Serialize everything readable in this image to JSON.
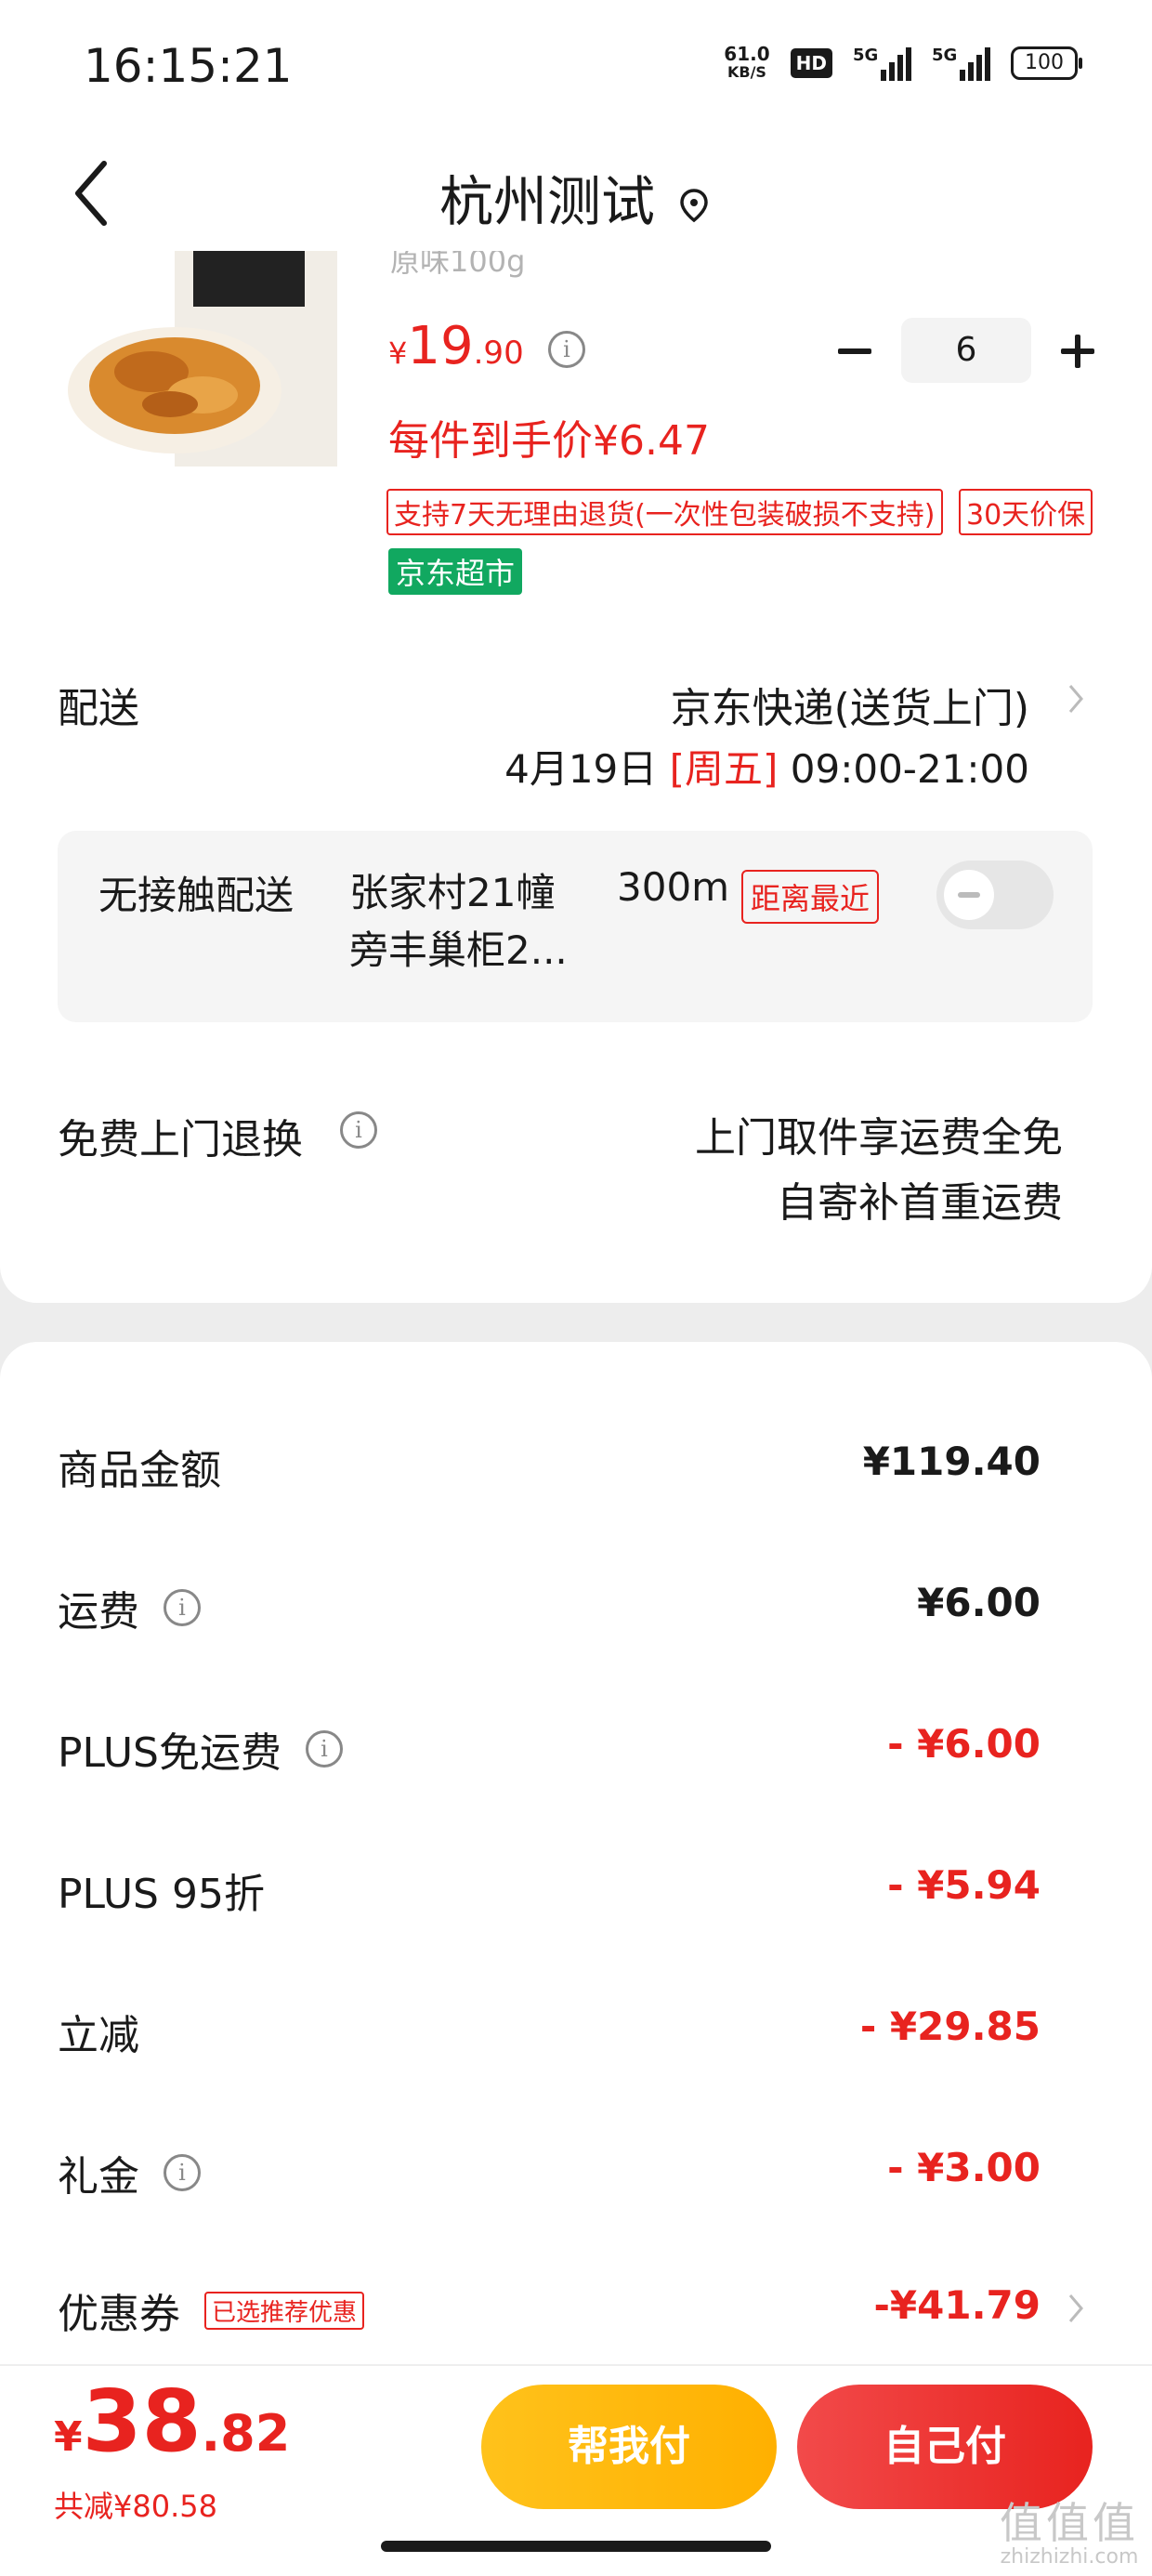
{
  "status_bar": {
    "time": "16:15:21",
    "net_speed_value": "61.0",
    "net_speed_unit": "KB/S",
    "hd_label": "HD",
    "signal1_label": "5G",
    "signal2_label": "5G",
    "battery": "100"
  },
  "nav": {
    "title": "杭州测试",
    "icons": [
      "back-icon",
      "location-pin-icon"
    ]
  },
  "product": {
    "spec": "原味100g",
    "price_symbol": "¥",
    "price_int": "19",
    "price_dec": ".90",
    "quantity": "6",
    "unit_price": "每件到手价¥6.47",
    "tags": [
      "支持7天无理由退货(一次性包装破损不支持)",
      "30天价保"
    ],
    "store_tag": "京东超市"
  },
  "delivery": {
    "label": "配送",
    "method": "京东快递(送货上门)",
    "date": "4月19日",
    "weekday": "[周五]",
    "time_window": "09:00-21:00"
  },
  "contactless": {
    "label": "无接触配送",
    "address": "张家村21幢旁丰巢柜2...",
    "distance": "300m",
    "badge": "距离最近",
    "enabled": false
  },
  "return_service": {
    "label": "免费上门退换",
    "line1": "上门取件享运费全免",
    "line2": "自寄补首重运费"
  },
  "fees": [
    {
      "label": "商品金额",
      "value": "¥119.40",
      "red": false,
      "info": false
    },
    {
      "label": "运费",
      "value": "¥6.00",
      "red": false,
      "info": true
    },
    {
      "label": "PLUS免运费",
      "value": "- ¥6.00",
      "red": true,
      "info": true
    },
    {
      "label": "PLUS 95折",
      "value": "- ¥5.94",
      "red": true,
      "info": false
    },
    {
      "label": "立减",
      "value": "- ¥29.85",
      "red": true,
      "info": false
    },
    {
      "label": "礼金",
      "value": "- ¥3.00",
      "red": true,
      "info": true
    },
    {
      "label": "优惠券",
      "value": "-¥41.79",
      "red": true,
      "info": false,
      "tag": "已选推荐优惠"
    }
  ],
  "footer": {
    "total_symbol": "¥",
    "total_int": "38",
    "total_dec": ".82",
    "total_saved": "共减¥80.58",
    "help_pay": "帮我付",
    "self_pay": "自己付"
  },
  "watermark": {
    "main": "值值值",
    "sub": "zhizhizhi.com"
  },
  "colors": {
    "accent_red": "#e8231f",
    "store_green": "#11a860",
    "help_button_yellow": "#ffb800"
  }
}
